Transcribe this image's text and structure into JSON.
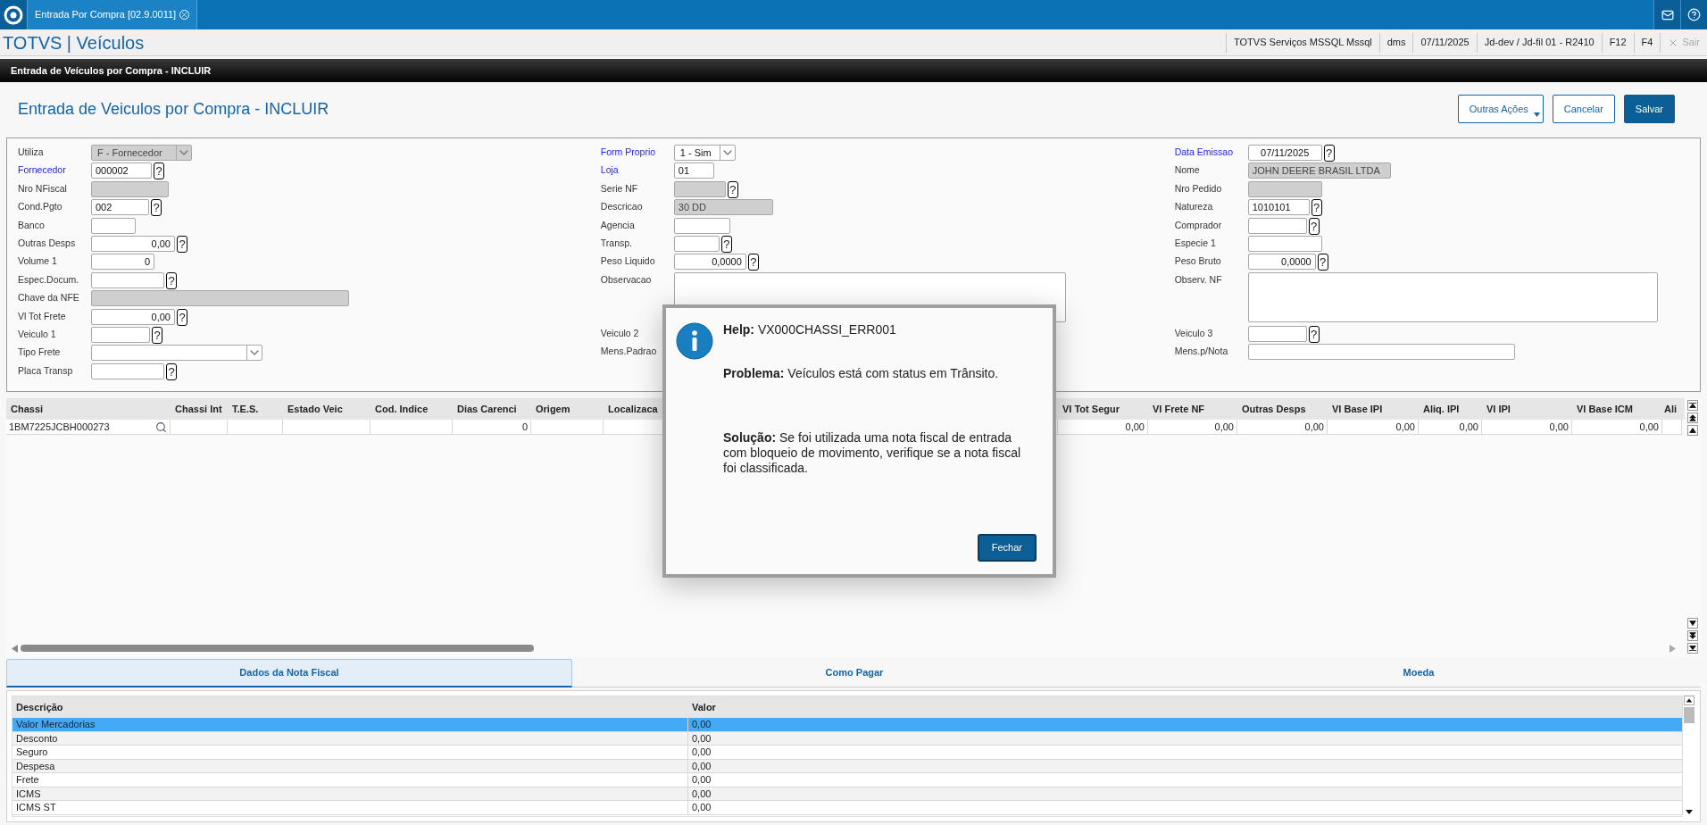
{
  "app_bar": {
    "tab_title": "Entrada Por Compra [02.9.0011]"
  },
  "header": {
    "brand": "TOTVS | Veículos",
    "items": [
      "TOTVS Serviços MSSQL Mssql",
      "dms",
      "07/11/2025",
      "Jd-dev / Jd-fil 01 - R2410",
      "F12",
      "F4"
    ],
    "exit": {
      "label": "Sair",
      "disabled": true
    }
  },
  "section_bar": "Entrada de Veículos por Compra - INCLUIR",
  "page_title": "Entrada de Veiculos por Compra - INCLUIR",
  "actions": [
    {
      "label": "Outras Ações",
      "kind": "menu"
    },
    {
      "label": "Cancelar",
      "kind": "secondary"
    },
    {
      "label": "Salvar",
      "kind": "primary"
    }
  ],
  "form": {
    "columns": [
      [
        {
          "label": "Utiliza",
          "kind": "select",
          "value": "F - Fornecedor",
          "required": false,
          "disabled": true
        },
        {
          "label": "Fornecedor",
          "kind": "text",
          "value": "000002",
          "help": "?",
          "required": true,
          "disabled": false
        },
        {
          "label": "Nro NFiscal",
          "kind": "text",
          "required": false,
          "disabled": true
        },
        {
          "label": "Cond.Pgto",
          "kind": "text",
          "value": "002",
          "help": "?",
          "required": false,
          "disabled": false
        },
        {
          "label": "Banco",
          "kind": "text",
          "required": false,
          "disabled": false
        },
        {
          "label": "Outras Desps",
          "kind": "number",
          "value": "0,00",
          "help": "?",
          "required": false,
          "disabled": false
        },
        {
          "label": "Volume 1",
          "kind": "number",
          "value": "0",
          "required": false,
          "disabled": false
        },
        {
          "label": "Espec.Docum.",
          "kind": "text",
          "help": "?",
          "required": false,
          "disabled": false
        },
        {
          "label": "Chave da NFE",
          "kind": "text",
          "required": false,
          "disabled": true
        },
        {
          "label": "Vl Tot Frete",
          "kind": "number",
          "value": "0,00",
          "help": "?",
          "required": false,
          "disabled": false
        },
        {
          "label": "Veiculo 1",
          "kind": "text",
          "help": "?",
          "required": false,
          "disabled": false
        },
        {
          "label": "Tipo Frete",
          "kind": "select",
          "required": false,
          "disabled": false
        },
        {
          "label": "Placa Transp",
          "kind": "text",
          "help": "?",
          "required": false,
          "disabled": false
        }
      ],
      [
        {
          "label": "Form Proprio",
          "kind": "select",
          "value": "1 - Sim",
          "required": true,
          "disabled": false
        },
        {
          "label": "Loja",
          "kind": "text",
          "value": "01",
          "required": true,
          "disabled": false
        },
        {
          "label": "Serie NF",
          "kind": "text",
          "help": "?",
          "required": false,
          "disabled": true
        },
        {
          "label": "Descricao",
          "kind": "text",
          "value": "30 DD",
          "required": false,
          "disabled": true
        },
        {
          "label": "Agencia",
          "kind": "text",
          "required": false,
          "disabled": false
        },
        {
          "label": "Transp.",
          "kind": "text",
          "help": "?",
          "required": false,
          "disabled": false
        },
        {
          "label": "Peso Liquido",
          "kind": "number",
          "value": "0,0000",
          "help": "?",
          "required": false,
          "disabled": false
        },
        {
          "label": "Observacao",
          "kind": "textarea",
          "required": false,
          "disabled": false
        },
        {
          "label": "Veiculo 2",
          "required": false
        },
        {
          "label": "Mens.Padrao",
          "required": false
        }
      ],
      [
        {
          "label": "Data Emissao",
          "kind": "date",
          "value": "07/11/2025",
          "help": "?",
          "required": true,
          "disabled": false
        },
        {
          "label": "Nome",
          "kind": "text",
          "value": "JOHN DEERE BRASIL LTDA",
          "required": false,
          "disabled": true
        },
        {
          "label": "Nro Pedido",
          "kind": "text",
          "required": false,
          "disabled": true
        },
        {
          "label": "Natureza",
          "kind": "text",
          "value": "1010101",
          "help": "?",
          "required": false,
          "disabled": false
        },
        {
          "label": "Comprador",
          "kind": "text",
          "help": "?",
          "required": false,
          "disabled": false
        },
        {
          "label": "Especie 1",
          "kind": "text",
          "required": false,
          "disabled": false
        },
        {
          "label": "Peso Bruto",
          "kind": "number",
          "value": "0,0000",
          "help": "?",
          "required": false,
          "disabled": false
        },
        {
          "label": "Observ. NF",
          "kind": "textarea",
          "required": false,
          "disabled": false
        },
        {
          "label": "Veiculo 3",
          "kind": "text",
          "help": "?",
          "required": false,
          "disabled": false
        },
        {
          "label": "Mens.p/Nota",
          "kind": "text",
          "required": false,
          "disabled": false
        }
      ]
    ]
  },
  "grid": {
    "columns": [
      {
        "label": "Chassi",
        "kind": "lookup"
      },
      {
        "label": "Chassi Int",
        "kind": "text"
      },
      {
        "label": "T.E.S.",
        "kind": "text"
      },
      {
        "label": "Estado Veic",
        "kind": "text"
      },
      {
        "label": "Cod. Indice",
        "kind": "text"
      },
      {
        "label": "Dias Carenci",
        "kind": "number"
      },
      {
        "label": "Origem",
        "kind": "text"
      },
      {
        "label": "Localizaca",
        "kind": "text"
      },
      {
        "label": "VI Tot Segur",
        "kind": "number"
      },
      {
        "label": "VI Frete NF",
        "kind": "number"
      },
      {
        "label": "Outras Desps",
        "kind": "number"
      },
      {
        "label": "VI Base IPI",
        "kind": "number"
      },
      {
        "label": "Aliq. IPI",
        "kind": "number"
      },
      {
        "label": "VI IPI",
        "kind": "number"
      },
      {
        "label": "VI Base ICM",
        "kind": "number"
      },
      {
        "label": "Ali",
        "kind": "number"
      }
    ],
    "rows": [
      {
        "cells": [
          "1BM7225JCBH000273",
          null,
          null,
          null,
          null,
          "0",
          null,
          null,
          "0,00",
          "0,00",
          "0,00",
          "0,00",
          "0,00",
          "0,00",
          "0,00",
          null
        ]
      }
    ]
  },
  "tabs": [
    {
      "label": "Dados da Nota Fiscal",
      "selected": true
    },
    {
      "label": "Como Pagar",
      "selected": false
    },
    {
      "label": "Moeda",
      "selected": false
    }
  ],
  "totals": {
    "columns": [
      "Descrição",
      "Valor"
    ],
    "rows": [
      {
        "cells": [
          "Valor Mercadorias",
          "0,00"
        ],
        "selected": true
      },
      {
        "cells": [
          "Desconto",
          "0,00"
        ],
        "selected": false
      },
      {
        "cells": [
          "Seguro",
          "0,00"
        ],
        "selected": false
      },
      {
        "cells": [
          "Despesa",
          "0,00"
        ],
        "selected": false
      },
      {
        "cells": [
          "Frete",
          "0,00"
        ],
        "selected": false
      },
      {
        "cells": [
          "ICMS",
          "0,00"
        ],
        "selected": false
      },
      {
        "cells": [
          "ICMS ST",
          "0,00"
        ],
        "selected": false
      }
    ]
  },
  "dialog": {
    "help": "**Help:** VX000CHASSI_ERR001",
    "problem": "**Problema:** Veículos está com status em Trânsito.",
    "solution": "**Solução:** Se foi utilizada uma nota fiscal de entrada com bloqueio de movimento, verifique se a nota fiscal foi classificada.",
    "button": "Fechar"
  }
}
